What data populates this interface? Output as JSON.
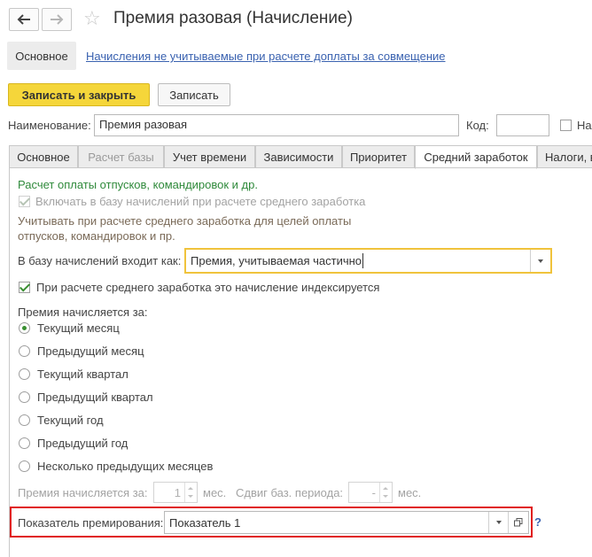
{
  "window": {
    "title": "Премия разовая (Начисление)"
  },
  "section_nav": {
    "main_label": "Основное",
    "link_label": "Начисления не учитываемые при расчете доплаты за совмещение"
  },
  "toolbar": {
    "save_close_label": "Записать и закрыть",
    "save_label": "Записать"
  },
  "form": {
    "name_label": "Наименование:",
    "name_value": "Премия разовая",
    "code_label": "Код:",
    "code_value": "",
    "cut_checkbox_label": "На"
  },
  "tabs": [
    {
      "label": "Основное"
    },
    {
      "label": "Расчет базы"
    },
    {
      "label": "Учет времени"
    },
    {
      "label": "Зависимости"
    },
    {
      "label": "Приоритет"
    },
    {
      "label": "Средний заработок"
    },
    {
      "label": "Налоги, вз"
    }
  ],
  "panel": {
    "section_heading": "Расчет оплаты отпусков, командировок и др.",
    "include_checkbox_label": "Включать в базу начислений при расчете среднего заработка",
    "hint_line1": "Учитывать при расчете среднего заработка для целей оплаты",
    "hint_line2": "отпусков, командировок и пр.",
    "base_label": "В базу начислений входит как:",
    "base_value": "Премия, учитываемая частично",
    "index_checkbox_label": "При расчете среднего заработка это начисление индексируется",
    "period_heading": "Премия начисляется за:",
    "period_options": [
      {
        "label": "Текущий месяц",
        "selected": true
      },
      {
        "label": "Предыдущий месяц",
        "selected": false
      },
      {
        "label": "Текущий квартал",
        "selected": false
      },
      {
        "label": "Предыдущий квартал",
        "selected": false
      },
      {
        "label": "Текущий год",
        "selected": false
      },
      {
        "label": "Предыдущий год",
        "selected": false
      },
      {
        "label": "Несколько предыдущих месяцев",
        "selected": false
      }
    ],
    "months_label": "Премия начисляется за:",
    "months_value": "1",
    "months_unit": "мес.",
    "shift_label": "Сдвиг баз. периода:",
    "shift_value": "-",
    "shift_unit": "мес.",
    "indicator_label": "Показатель премирования:",
    "indicator_value": "Показатель 1",
    "help_label": "?"
  },
  "colors": {
    "primary_button": "#f5d63a",
    "heading_green": "#2f8a3b",
    "highlight_red": "#e01b1b",
    "focus_yellow": "#f0c33c",
    "link_blue": "#3a62b0"
  }
}
